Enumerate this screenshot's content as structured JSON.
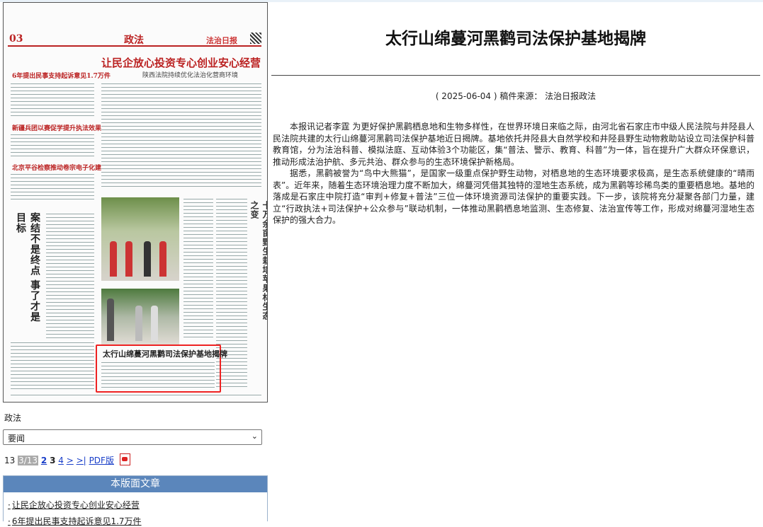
{
  "thumbnail": {
    "page_no": "03",
    "section": "政法",
    "paper_name": "法治日报",
    "lead_headline": "让民企放心投资专心创业安心经营",
    "lead_subhead": "陕西法院持续优化法治化营商环境",
    "side_headlines": [
      "6年提出民事支持起诉意见1.7万件",
      "新疆兵团以赛促学提升执法效果",
      "北京平谷检察推动卷宗电子化建设"
    ],
    "vertical_headline_1": "案结不是终点 事了才是目标",
    "vertical_headline_2": "十万余亩野生栽培苹果林生态之变",
    "boxed_headline": "太行山绵蔓河黑鹳司法保护基地揭牌"
  },
  "nav": {
    "section_label": "政法",
    "select_value": "要闻",
    "pager": {
      "prefix": "13",
      "current": "3/13",
      "prev": "2",
      "this": "3",
      "next": "4",
      "next_arrow": ">",
      "last_arrow": ">|",
      "pdf_label": "PDF版"
    },
    "articles_header": "本版面文章",
    "articles": [
      "让民企放心投资专心创业安心经营",
      "6年提出民事支持起诉意见1.7万件"
    ]
  },
  "article": {
    "title": "太行山绵蔓河黑鹳司法保护基地揭牌",
    "meta": "( 2025-06-04 ) 稿件来源：  法治日报政法",
    "paragraphs": [
      "本报讯记者李霆 为更好保护黑鹳栖息地和生物多样性，在世界环境日来临之际，由河北省石家庄市中级人民法院与井陉县人民法院共建的太行山绵蔓河黑鹳司法保护基地近日揭牌。基地依托井陉县大自然学校和井陉县野生动物救助站设立司法保护科普教育馆，分为法治科普、模拟法庭、互动体验3个功能区，集“普法、警示、教育、科普”为一体，旨在提升广大群众环保意识，推动形成法治护航、多元共治、群众参与的生态环境保护新格局。",
      "据悉，黑鹳被誉为“鸟中大熊猫”，是国家一级重点保护野生动物，对栖息地的生态环境要求极高，是生态系统健康的“晴雨表”。近年来，随着生态环境治理力度不断加大，绵蔓河凭借其独特的湿地生态系统，成为黑鹳等珍稀鸟类的重要栖息地。基地的落成是石家庄中院打造“审判+修复+普法”三位一体环境资源司法保护的重要实践。下一步，该院将充分凝聚各部门力量，建立“行政执法+司法保护+公众参与”联动机制，一体推动黑鹳栖息地监测、生态修复、法治宣传等工作，形成对绵蔓河湿地生态保护的强大合力。"
    ]
  }
}
